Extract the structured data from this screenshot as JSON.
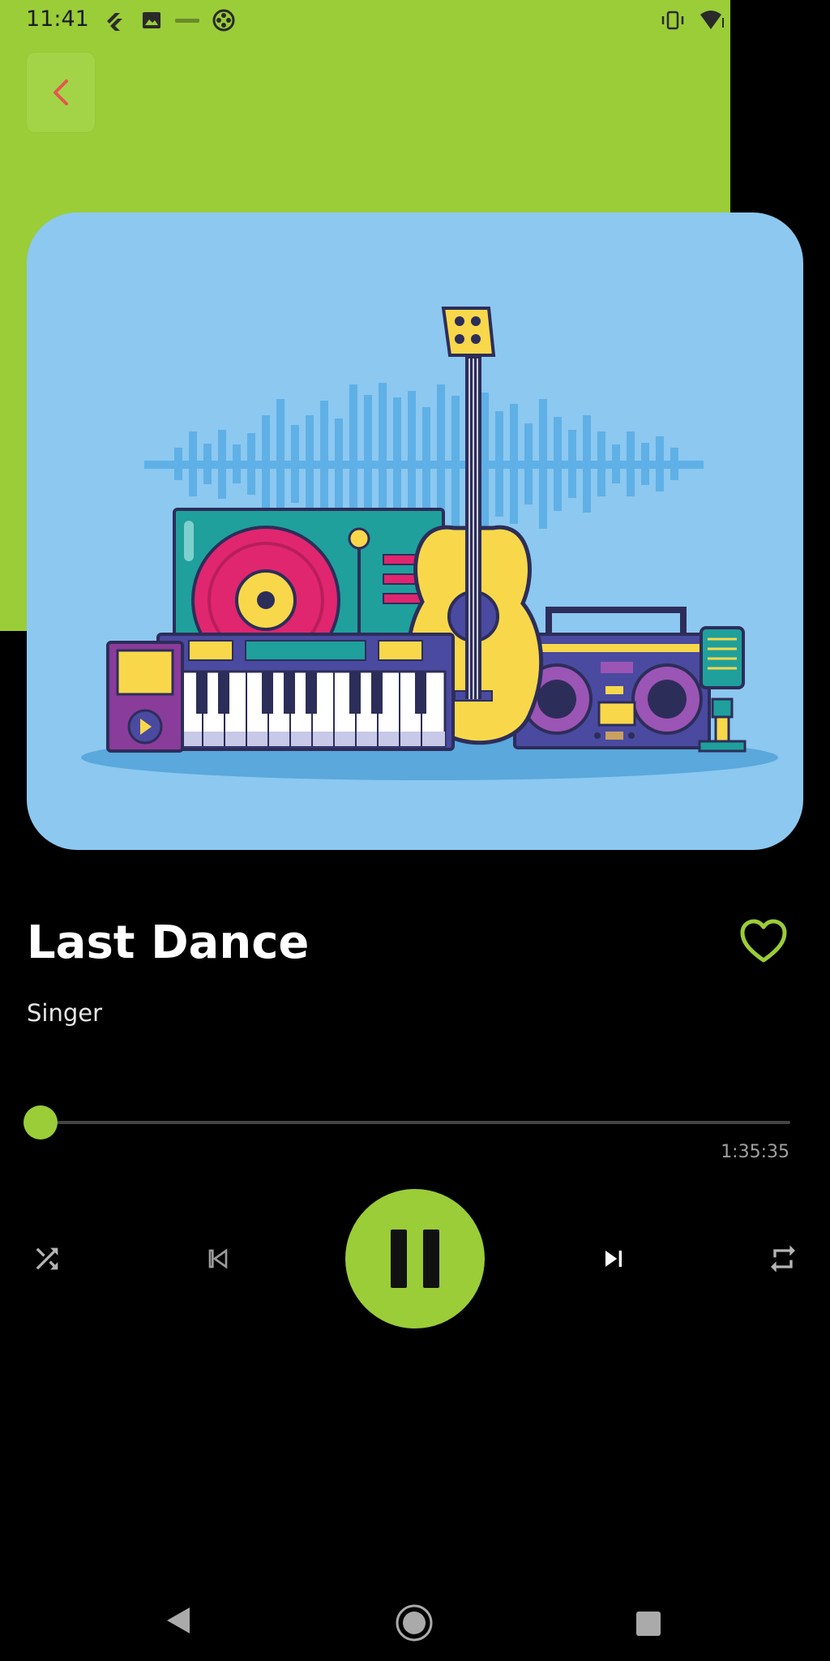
{
  "status_bar": {
    "time": "11:41",
    "left_icons": [
      "flutter-icon",
      "image-icon",
      "app-icon",
      "film-reel-icon"
    ],
    "right_icons": [
      "vibrate-icon",
      "wifi-icon"
    ]
  },
  "header": {
    "back_icon": "chevron-left-icon"
  },
  "album_art": {
    "description_icon": "music-instruments-illustration",
    "background_color": "#8cc8f0"
  },
  "track": {
    "title": "Last Dance",
    "artist": "Singer",
    "favorite_icon": "heart-outline-icon"
  },
  "progress": {
    "position_fraction": 0.0,
    "duration": "1:35:35"
  },
  "controls": {
    "shuffle_icon": "shuffle-icon",
    "previous_icon": "skip-previous-icon",
    "play_pause_icon": "pause-icon",
    "next_icon": "skip-next-icon",
    "repeat_icon": "repeat-icon"
  },
  "colors": {
    "accent": "#9ACD38",
    "background": "#000000",
    "back_arrow": "#e4574f"
  },
  "system_nav": {
    "back_icon": "nav-back-icon",
    "home_icon": "nav-home-icon",
    "recents_icon": "nav-recents-icon"
  }
}
